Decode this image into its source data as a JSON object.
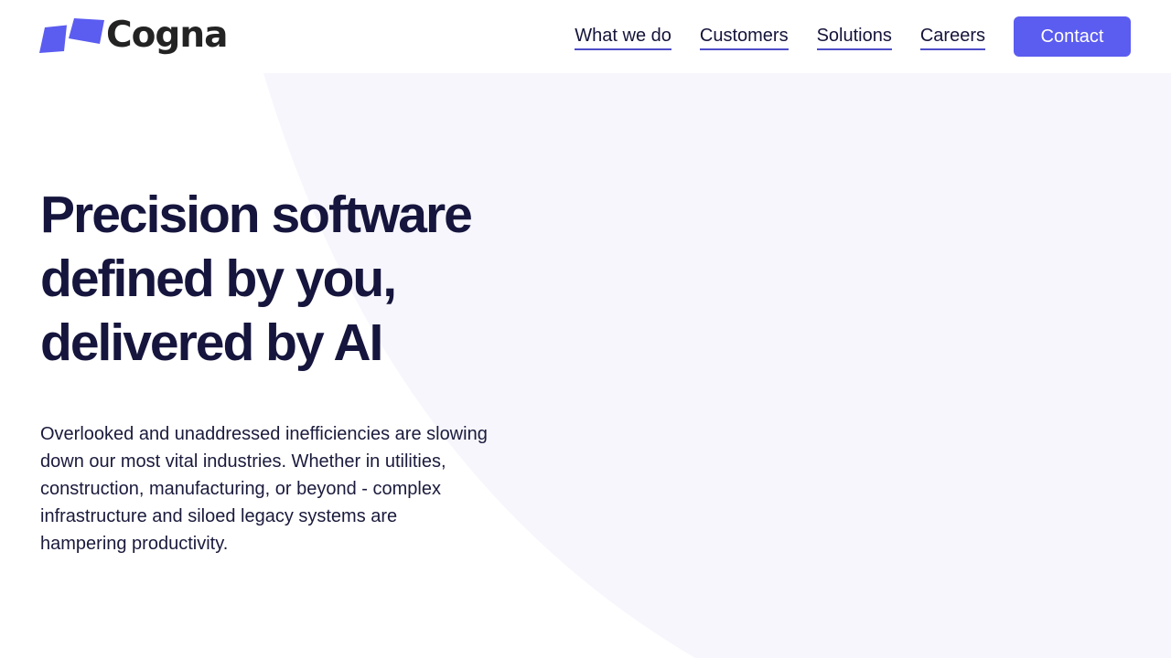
{
  "brand": {
    "name": "Cogna",
    "mark_icon": "cogna-parallelogram-logo-icon",
    "accent_color": "#5b5cf0"
  },
  "nav": {
    "links": [
      {
        "label": "What we do"
      },
      {
        "label": "Customers"
      },
      {
        "label": "Solutions"
      },
      {
        "label": "Careers"
      }
    ],
    "contact_label": "Contact"
  },
  "hero": {
    "title_lines": [
      "Precision software",
      "defined by you,",
      "delivered by AI"
    ],
    "body_lines": [
      "Overlooked and unaddressed inefficiencies are slowing",
      "down our most vital industries. Whether in utilities,",
      "construction, manufacturing, or beyond - complex",
      "infrastructure and siloed legacy systems are",
      "hampering productivity."
    ]
  },
  "colors": {
    "heading": "#15153d",
    "background_shape": "#f6f6fc"
  }
}
